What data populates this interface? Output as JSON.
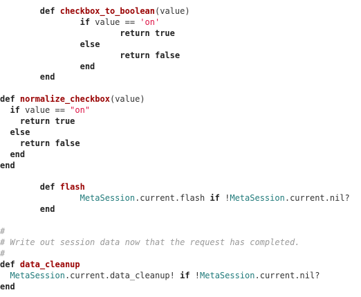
{
  "code": {
    "lines": [
      [
        {
          "t": "        ",
          "k": "id"
        },
        {
          "t": "def",
          "k": "kw"
        },
        {
          "t": " ",
          "k": "id"
        },
        {
          "t": "checkbox_to_boolean",
          "k": "fn"
        },
        {
          "t": "(value)",
          "k": "id"
        }
      ],
      [
        {
          "t": "                ",
          "k": "id"
        },
        {
          "t": "if",
          "k": "kw"
        },
        {
          "t": " value == ",
          "k": "id"
        },
        {
          "t": "'on'",
          "k": "str"
        }
      ],
      [
        {
          "t": "                        ",
          "k": "id"
        },
        {
          "t": "return",
          "k": "kw"
        },
        {
          "t": " ",
          "k": "id"
        },
        {
          "t": "true",
          "k": "kw"
        }
      ],
      [
        {
          "t": "                ",
          "k": "id"
        },
        {
          "t": "else",
          "k": "kw"
        }
      ],
      [
        {
          "t": "                        ",
          "k": "id"
        },
        {
          "t": "return",
          "k": "kw"
        },
        {
          "t": " ",
          "k": "id"
        },
        {
          "t": "false",
          "k": "kw"
        }
      ],
      [
        {
          "t": "                ",
          "k": "id"
        },
        {
          "t": "end",
          "k": "kw"
        }
      ],
      [
        {
          "t": "        ",
          "k": "id"
        },
        {
          "t": "end",
          "k": "kw"
        }
      ],
      [],
      [
        {
          "t": "def",
          "k": "kw"
        },
        {
          "t": " ",
          "k": "id"
        },
        {
          "t": "normalize_checkbox",
          "k": "fn"
        },
        {
          "t": "(value)",
          "k": "id"
        }
      ],
      [
        {
          "t": "  ",
          "k": "id"
        },
        {
          "t": "if",
          "k": "kw"
        },
        {
          "t": " value == ",
          "k": "id"
        },
        {
          "t": "\"on\"",
          "k": "str"
        }
      ],
      [
        {
          "t": "    ",
          "k": "id"
        },
        {
          "t": "return",
          "k": "kw"
        },
        {
          "t": " ",
          "k": "id"
        },
        {
          "t": "true",
          "k": "kw"
        }
      ],
      [
        {
          "t": "  ",
          "k": "id"
        },
        {
          "t": "else",
          "k": "kw"
        }
      ],
      [
        {
          "t": "    ",
          "k": "id"
        },
        {
          "t": "return",
          "k": "kw"
        },
        {
          "t": " ",
          "k": "id"
        },
        {
          "t": "false",
          "k": "kw"
        }
      ],
      [
        {
          "t": "  ",
          "k": "id"
        },
        {
          "t": "end",
          "k": "kw"
        }
      ],
      [
        {
          "t": "end",
          "k": "kw"
        }
      ],
      [],
      [
        {
          "t": "        ",
          "k": "id"
        },
        {
          "t": "def",
          "k": "kw"
        },
        {
          "t": " ",
          "k": "id"
        },
        {
          "t": "flash",
          "k": "fn"
        }
      ],
      [
        {
          "t": "                ",
          "k": "id"
        },
        {
          "t": "MetaSession",
          "k": "const"
        },
        {
          "t": ".current.flash ",
          "k": "id"
        },
        {
          "t": "if",
          "k": "kw"
        },
        {
          "t": " !",
          "k": "id"
        },
        {
          "t": "MetaSession",
          "k": "const"
        },
        {
          "t": ".current.nil?",
          "k": "id"
        }
      ],
      [
        {
          "t": "        ",
          "k": "id"
        },
        {
          "t": "end",
          "k": "kw"
        }
      ],
      [],
      [
        {
          "t": "#",
          "k": "cm"
        }
      ],
      [
        {
          "t": "# Write out session data now that the request has completed.",
          "k": "cm"
        }
      ],
      [
        {
          "t": "#",
          "k": "cm"
        }
      ],
      [
        {
          "t": "def",
          "k": "kw"
        },
        {
          "t": " ",
          "k": "id"
        },
        {
          "t": "data_cleanup",
          "k": "fn"
        }
      ],
      [
        {
          "t": "  ",
          "k": "id"
        },
        {
          "t": "MetaSession",
          "k": "const"
        },
        {
          "t": ".current.data_cleanup! ",
          "k": "id"
        },
        {
          "t": "if",
          "k": "kw"
        },
        {
          "t": " !",
          "k": "id"
        },
        {
          "t": "MetaSession",
          "k": "const"
        },
        {
          "t": ".current.nil?",
          "k": "id"
        }
      ],
      [
        {
          "t": "end",
          "k": "kw"
        }
      ]
    ]
  },
  "colors": {
    "background": "#ffffff",
    "keyword": "#222222",
    "function_name": "#990000",
    "string": "#d14",
    "constant": "#1f7a7a",
    "comment": "#999999",
    "identifier": "#333333"
  }
}
